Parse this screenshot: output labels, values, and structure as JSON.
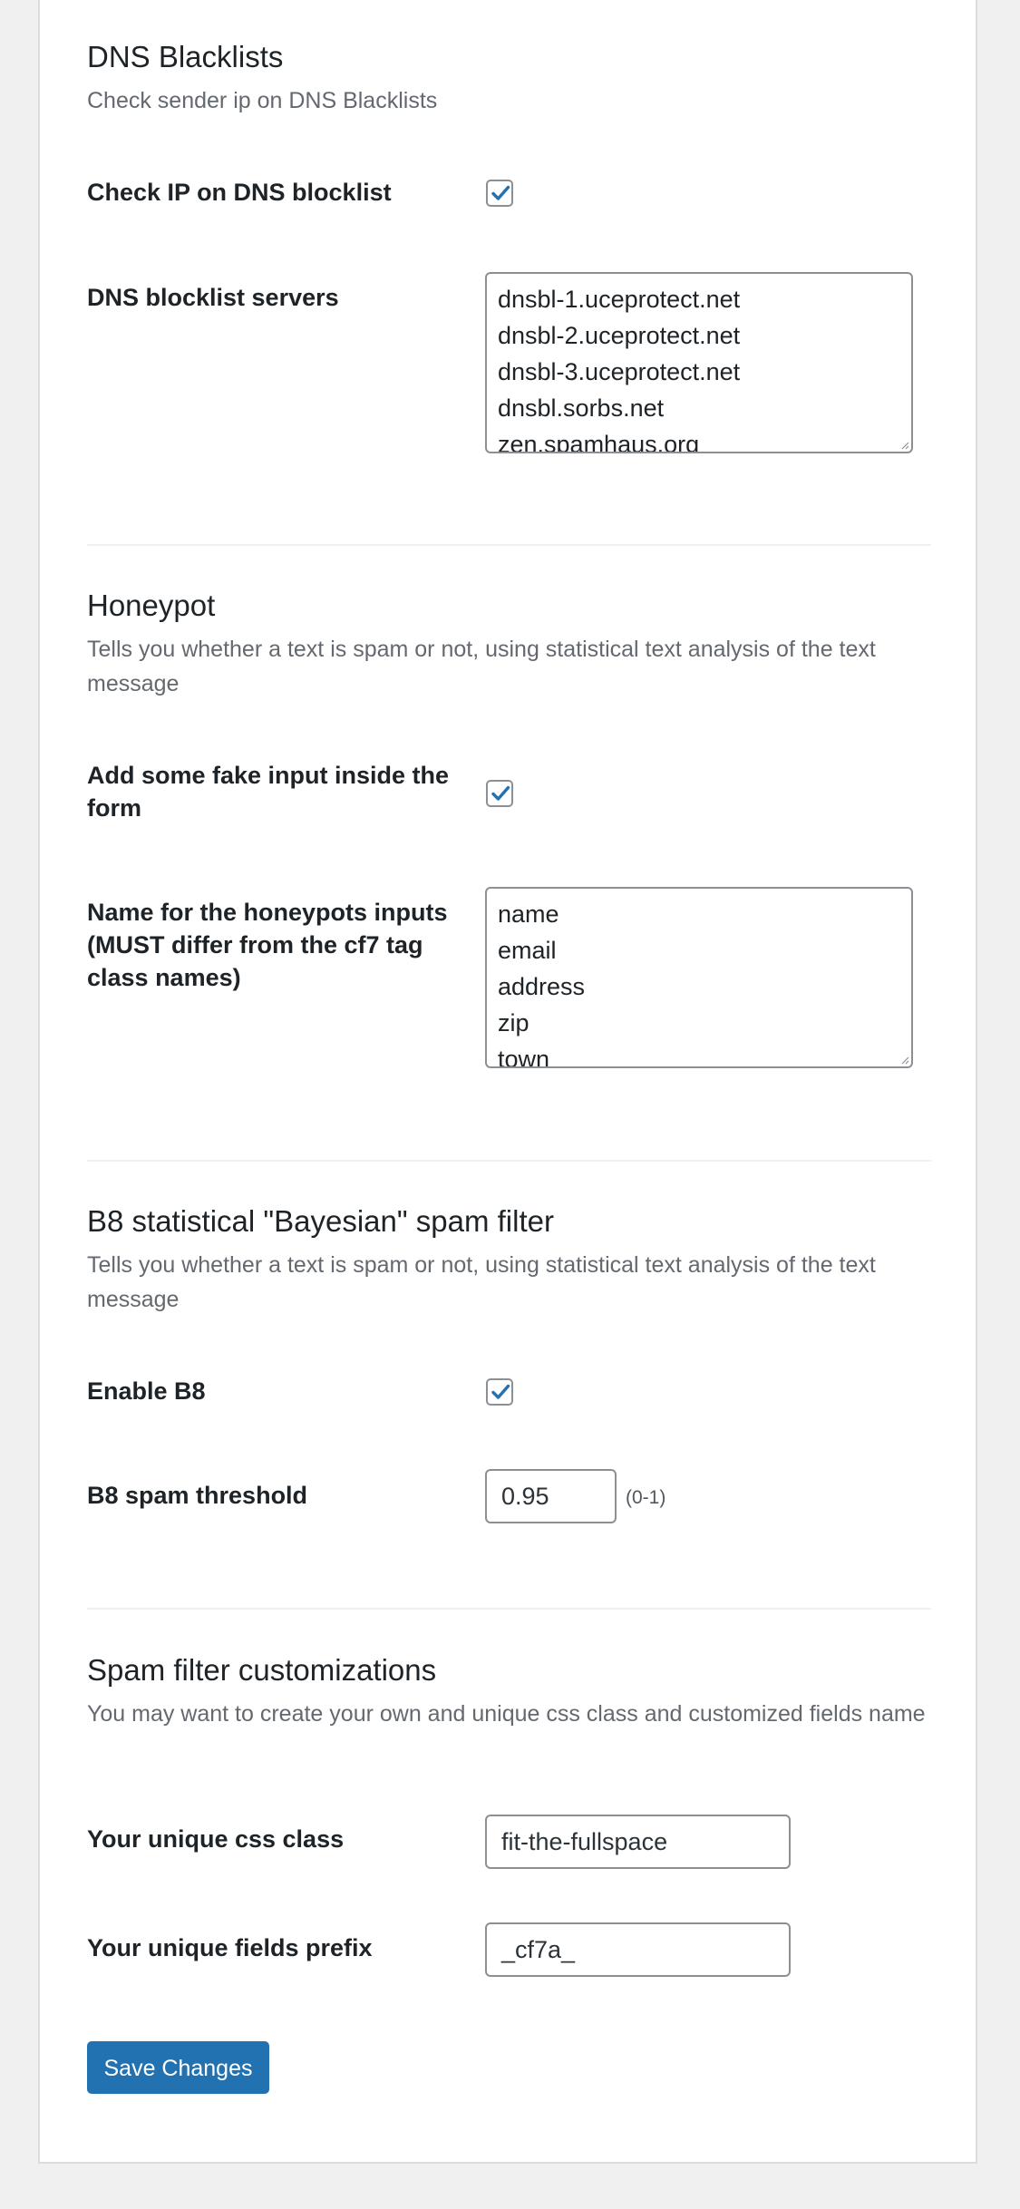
{
  "sections": {
    "dnsbl": {
      "title": "DNS Blacklists",
      "description": "Check sender ip on DNS Blacklists",
      "check_ip_label": "Check IP on DNS blocklist",
      "check_ip_checked": true,
      "servers_label": "DNS blocklist servers",
      "servers": [
        "dnsbl-1.uceprotect.net",
        "dnsbl-2.uceprotect.net",
        "dnsbl-3.uceprotect.net",
        "dnsbl.sorbs.net",
        "zen.spamhaus.org"
      ]
    },
    "honeypot": {
      "title": "Honeypot",
      "description": "Tells you whether a text is spam or not, using statistical text analysis of the text message",
      "fake_input_label": "Add some fake input inside the form",
      "fake_input_checked": true,
      "names_label": "Name for the honeypots inputs (MUST differ from the cf7 tag class names)",
      "names": [
        "name",
        "email",
        "address",
        "zip",
        "town"
      ]
    },
    "b8": {
      "title": "B8 statistical \"Bayesian\" spam filter",
      "description": "Tells you whether a text is spam or not, using statistical text analysis of the text message",
      "enable_label": "Enable B8",
      "enable_checked": true,
      "threshold_label": "B8 spam threshold",
      "threshold_value": "0.95",
      "threshold_hint": "(0-1)"
    },
    "customizations": {
      "title": "Spam filter customizations",
      "description": "You may want to create your own and unique css class and customized fields name",
      "css_class_label": "Your unique css class",
      "css_class_value": "fit-the-fullspace",
      "prefix_label": "Your unique fields prefix",
      "prefix_value": "_cf7a_"
    }
  },
  "save_button_label": "Save Changes",
  "colors": {
    "accent": "#2271b1",
    "page_bg": "#f0f0f1",
    "card_bg": "#ffffff",
    "muted_text": "#646970"
  },
  "icons": {
    "checkbox_checked": "checkmark-icon",
    "textarea_resize": "resize-grip-icon"
  }
}
